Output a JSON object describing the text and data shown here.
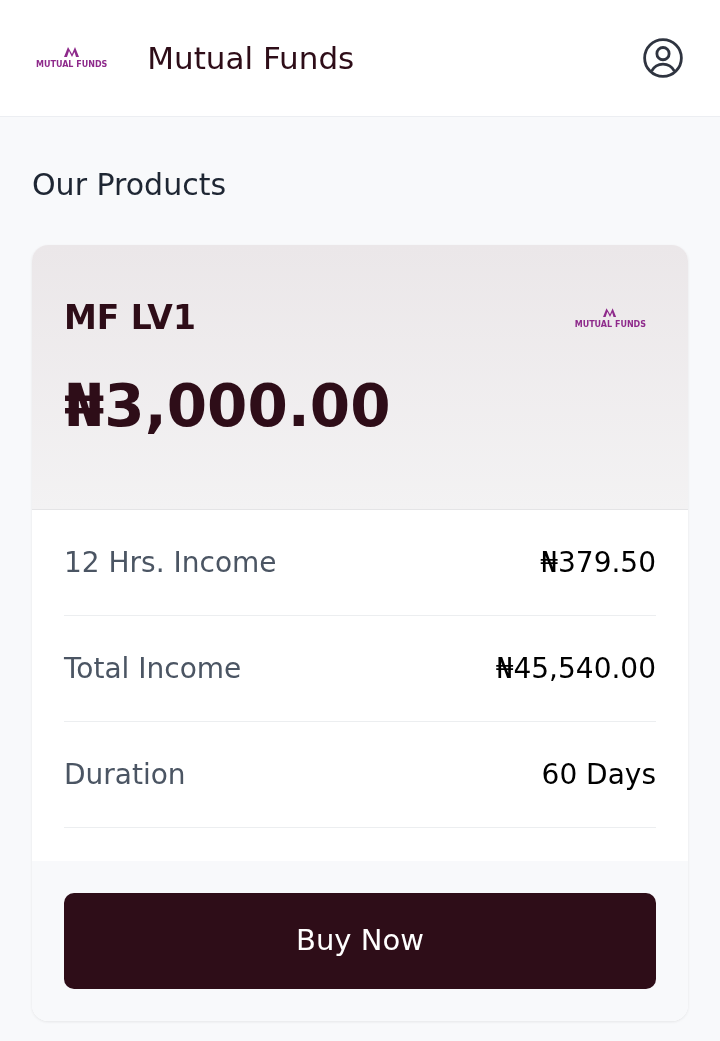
{
  "header": {
    "logo_text": "MUTUAL FUNDS",
    "title": "Mutual Funds"
  },
  "section_title": "Our Products",
  "product": {
    "name": "MF LV1",
    "logo_text": "MUTUAL FUNDS",
    "price": "₦3,000.00",
    "rows": [
      {
        "label": "12 Hrs. Income",
        "value": "₦379.50"
      },
      {
        "label": "Total Income",
        "value": "₦45,540.00"
      },
      {
        "label": "Duration",
        "value": "60 Days"
      }
    ],
    "button": "Buy Now"
  }
}
